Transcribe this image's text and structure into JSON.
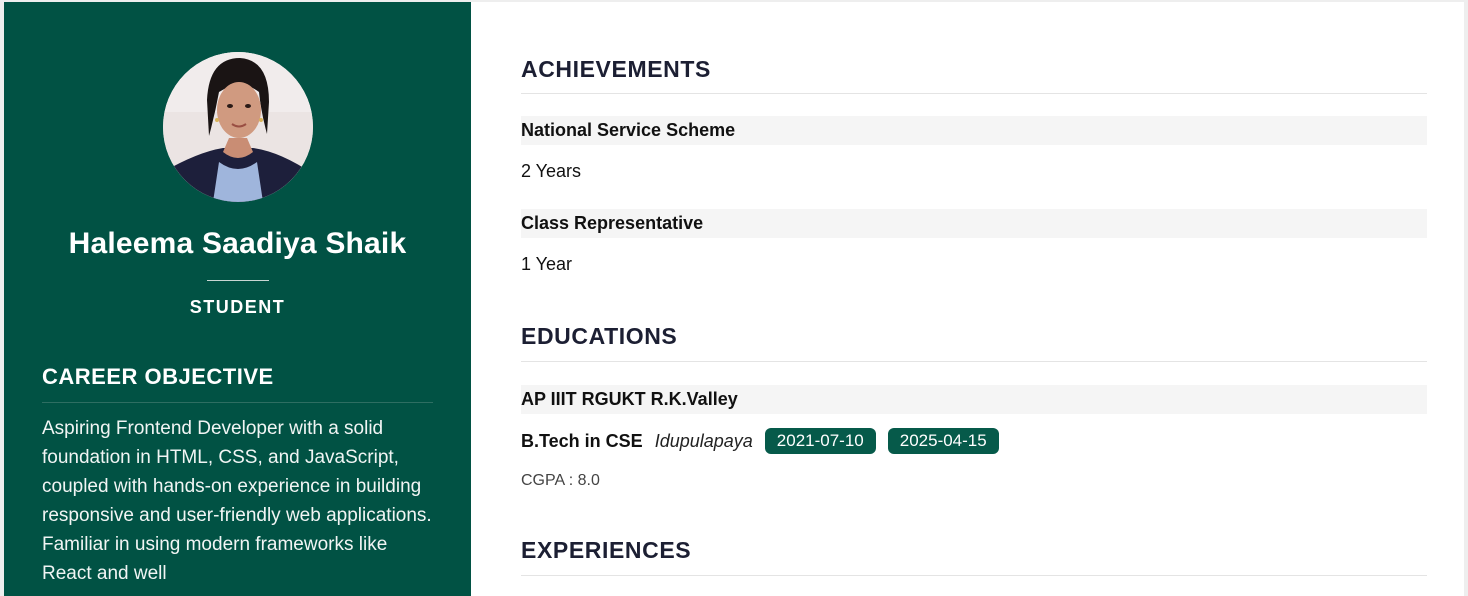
{
  "profile": {
    "name": "Haleema Saadiya Shaik",
    "role": "STUDENT"
  },
  "career_objective": {
    "heading": "CAREER OBJECTIVE",
    "text": "Aspiring Frontend Developer with a solid foundation in HTML, CSS, and JavaScript, coupled with hands-on experience in building responsive and user-friendly web applications. Familiar in using modern frameworks like React and well"
  },
  "achievements": {
    "heading": "ACHIEVEMENTS",
    "items": [
      {
        "title": "National Service Scheme",
        "duration": "2 Years"
      },
      {
        "title": "Class Representative",
        "duration": "1 Year"
      }
    ]
  },
  "educations": {
    "heading": "EDUCATIONS",
    "items": [
      {
        "institution": "AP IIIT RGUKT R.K.Valley",
        "degree": "B.Tech in CSE",
        "location": "Idupulapaya",
        "start_date": "2021-07-10",
        "end_date": "2025-04-15",
        "cgpa": "CGPA : 8.0"
      }
    ]
  },
  "experiences": {
    "heading": "EXPERIENCES"
  },
  "colors": {
    "sidebar": "#015244",
    "badge": "#065a4a",
    "heading": "#1c1f33"
  }
}
